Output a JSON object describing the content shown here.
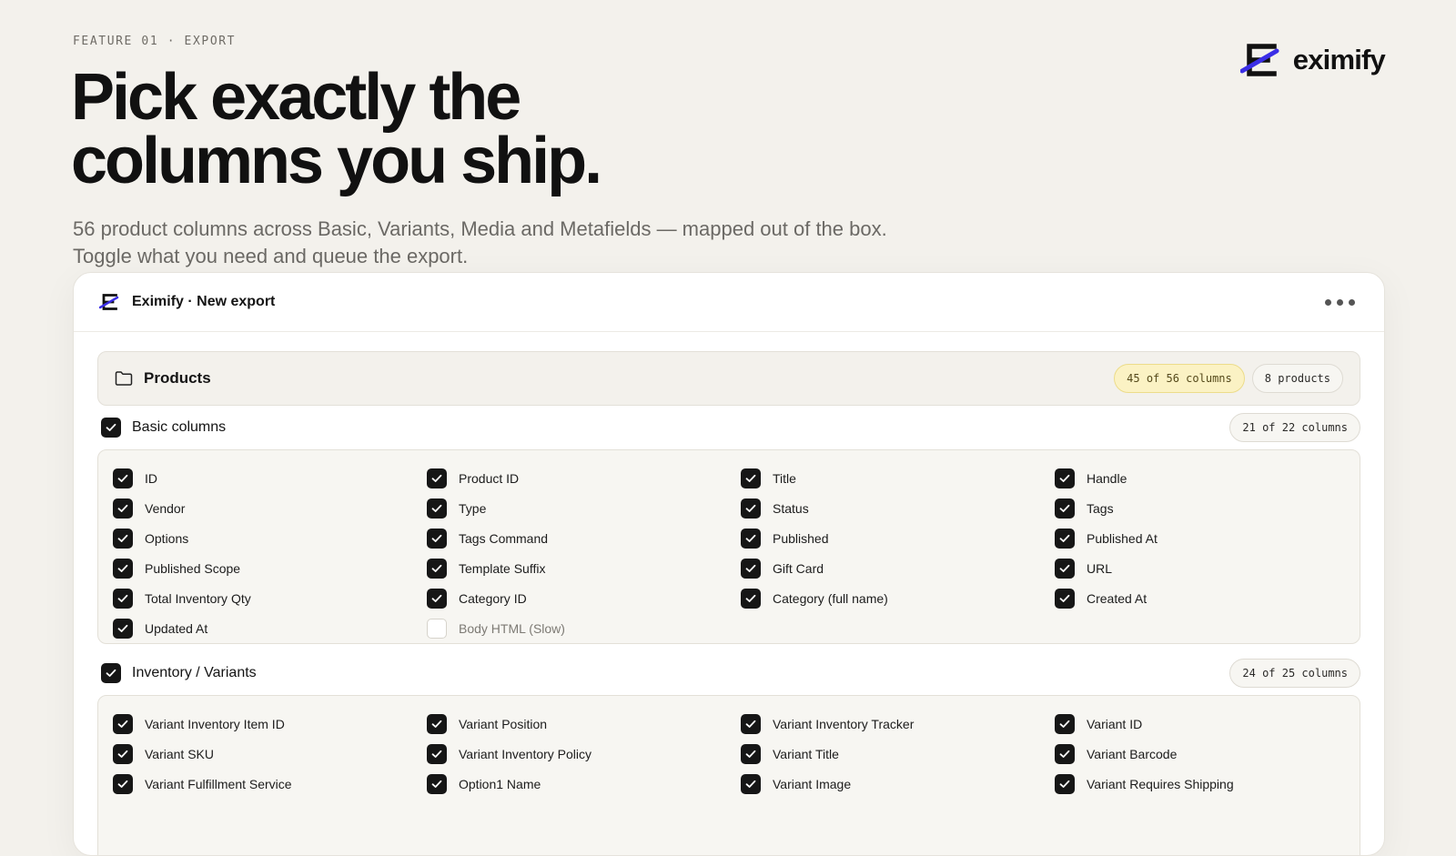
{
  "hero": {
    "eyebrow": "FEATURE 01 · EXPORT",
    "headline_line1": "Pick exactly the",
    "headline_line2": "columns you ship.",
    "subhead": "56 product columns across Basic, Variants, Media and Metafields — mapped out of the box. Toggle what you need and queue the export."
  },
  "brand": {
    "name": "eximify",
    "accent": "#3b2ee6"
  },
  "window": {
    "title": "Eximify · New export"
  },
  "products": {
    "title": "Products",
    "columns_badge": "45 of 56 columns",
    "products_badge": "8 products"
  },
  "sections": [
    {
      "title": "Basic columns",
      "count": "21 of 22 columns",
      "checked": true,
      "items": [
        {
          "label": "ID",
          "checked": true
        },
        {
          "label": "Product ID",
          "checked": true
        },
        {
          "label": "Title",
          "checked": true
        },
        {
          "label": "Handle",
          "checked": true
        },
        {
          "label": "Vendor",
          "checked": true
        },
        {
          "label": "Type",
          "checked": true
        },
        {
          "label": "Status",
          "checked": true
        },
        {
          "label": "Tags",
          "checked": true
        },
        {
          "label": "Options",
          "checked": true
        },
        {
          "label": "Tags Command",
          "checked": true
        },
        {
          "label": "Published",
          "checked": true
        },
        {
          "label": "Published At",
          "checked": true
        },
        {
          "label": "Published Scope",
          "checked": true
        },
        {
          "label": "Template Suffix",
          "checked": true
        },
        {
          "label": "Gift Card",
          "checked": true
        },
        {
          "label": "URL",
          "checked": true
        },
        {
          "label": "Total Inventory Qty",
          "checked": true
        },
        {
          "label": "Category ID",
          "checked": true
        },
        {
          "label": "Category (full name)",
          "checked": true
        },
        {
          "label": "Created At",
          "checked": true
        },
        {
          "label": "Updated At",
          "checked": true
        },
        {
          "label": "Body HTML (Slow)",
          "checked": false
        }
      ]
    },
    {
      "title": "Inventory / Variants",
      "count": "24 of 25 columns",
      "checked": true,
      "items": [
        {
          "label": "Variant Inventory Item ID",
          "checked": true
        },
        {
          "label": "Variant Position",
          "checked": true
        },
        {
          "label": "Variant Inventory Tracker",
          "checked": true
        },
        {
          "label": "Variant ID",
          "checked": true
        },
        {
          "label": "Variant SKU",
          "checked": true
        },
        {
          "label": "Variant Inventory Policy",
          "checked": true
        },
        {
          "label": "Variant Title",
          "checked": true
        },
        {
          "label": "Variant Barcode",
          "checked": true
        },
        {
          "label": "Variant Fulfillment Service",
          "checked": true
        },
        {
          "label": "Option1 Name",
          "checked": true
        },
        {
          "label": "Variant Image",
          "checked": true
        },
        {
          "label": "Variant Requires Shipping",
          "checked": true
        }
      ]
    }
  ]
}
